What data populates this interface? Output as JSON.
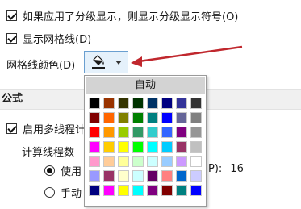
{
  "options": {
    "outline_symbols_label": "如果应用了分级显示，则显示分级显示符号(O)",
    "show_gridlines_label": "显示网格线(D)",
    "gridline_color_label": "网格线颜色(D)"
  },
  "section": {
    "formula_title": "公式"
  },
  "formula": {
    "multithread_label": "启用多线程计",
    "thread_count_label": "计算线程数",
    "use_all_label": "使用",
    "use_all_suffix": "P):",
    "thread_value": "16",
    "manual_label": "手动"
  },
  "palette": {
    "auto_label": "自动",
    "colors": [
      [
        "#000000",
        "#993300",
        "#333300",
        "#003300",
        "#003366",
        "#000080",
        "#333399",
        "#333333"
      ],
      [
        "#800000",
        "#FF6600",
        "#808000",
        "#008000",
        "#008080",
        "#0000FF",
        "#666699",
        "#808080"
      ],
      [
        "#FF0000",
        "#FF9900",
        "#99CC00",
        "#339966",
        "#33CCCC",
        "#3366FF",
        "#800080",
        "#969696"
      ],
      [
        "#FF00FF",
        "#FFCC00",
        "#FFFF00",
        "#00FF00",
        "#00FFFF",
        "#00CCFF",
        "#993366",
        "#C0C0C0"
      ],
      [
        "#FF99CC",
        "#FFCC99",
        "#FFFF99",
        "#CCFFCC",
        "#CCFFFF",
        "#99CCFF",
        "#CC99FF",
        "#FFFFFF"
      ],
      [
        "#9999FF",
        "#993366",
        "#FFFFCC",
        "#CCFFFF",
        "#660066",
        "#FF8080",
        "#0066CC",
        "#CCCCFF"
      ],
      [
        "#000080",
        "#FF00FF",
        "#FFFF00",
        "#00FFFF",
        "#800080",
        "#800000",
        "#008080",
        "#0000FF"
      ]
    ]
  },
  "colors": {
    "selected_button_bg": "#e5f1fb",
    "selected_button_border": "#6a9fd0",
    "arrow": "#c0272d"
  },
  "icons": {
    "paint_bucket": "paint-bucket-icon",
    "dropdown_caret": "chevron-down-icon"
  }
}
